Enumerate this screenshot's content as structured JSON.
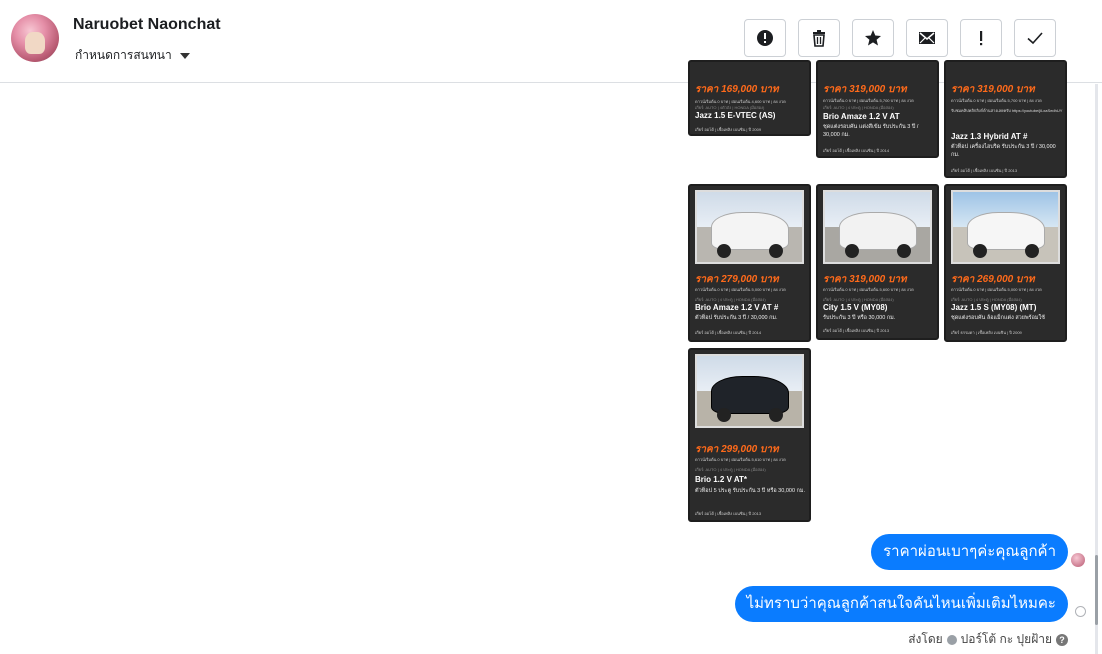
{
  "header": {
    "name": "Naruobet Naonchat",
    "subtitle": "กำหนดการสนทนา",
    "actions": [
      "alert-circle-icon",
      "trash-icon",
      "star-icon",
      "mail-icon",
      "exclamation-icon",
      "checkmark-icon"
    ]
  },
  "cards": [
    {
      "price": "ราคา 169,000 บาท",
      "finance": "ดาวน์เริ่มต้น 0 บาท | ผ่อนเริ่มต้น 4,600 บาท | 84 งวด",
      "spec": "เกียร์: AUTO | 4ตัวถัง | HONDA (มือสอง)",
      "model": "Jazz 1.5 E-VTEC (AS)",
      "desc": "",
      "foot": "เกียร์ ออโต้  |  เชื้อเพลิง เบนซิน  |  ปี 2009"
    },
    {
      "price": "ราคา 319,000 บาท",
      "finance": "ดาวน์เริ่มต้น 0 บาท | ผ่อนเริ่มต้น 5,700 บาท | 84 งวด",
      "spec": "เกียร์: AUTO | 4 ประตู | HONDA (มือสอง)",
      "model": "Brio Amaze 1.2 V AT",
      "desc": "ชุดแต่งรอบคัน แต่งสีเข้ม รับประกัน 3 ปี / 30,000 กม.",
      "foot": "เกียร์ ออโต้  |  เชื้อเพลิง เบนซิน  |  ปี 2014"
    },
    {
      "price": "ราคา 319,000 บาท",
      "finance": "ดาวน์เริ่มต้น 0 บาท | ผ่อนเริ่มต้น 5,700 บาท | 84 งวด",
      "spec": "รับชมคลิปคลิกลิงก์ด้านล่างเลยครับ https://youtube/jiLxaSedhUY",
      "model": "Jazz 1.3 Hybrid AT #",
      "desc": "ตัวท็อป เครื่องไฮบริด รับประกัน 3 ปี / 30,000 กม.",
      "foot": "เกียร์ ออโต้  |  เชื้อเพลิง เบนซิน  |  ปี 2013"
    },
    {
      "price": "ราคา 279,000 บาท",
      "finance": "ดาวน์เริ่มต้น 0 บาท | ผ่อนเริ่มต้น 5,000 บาท | 84 งวด",
      "spec": "เกียร์: AUTO | 4 ประตู | HONDA (มือสอง)",
      "model": "Brio Amaze 1.2 V AT #",
      "desc": "ตัวท็อป รับประกัน 3 ปี / 30,000 กม.",
      "foot": "เกียร์ ออโต้  |  เชื้อเพลิง เบนซิน  |  ปี 2014"
    },
    {
      "price": "ราคา 319,000 บาท",
      "finance": "ดาวน์เริ่มต้น 0 บาท | ผ่อนเริ่มต้น 5,600 บาท | 84 งวด",
      "spec": "เกียร์: AUTO | 4 ประตู | HONDA (มือสอง)",
      "model": "City 1.5 V (MY08)",
      "desc": "รับประกัน 3 ปี หรือ 30,000 กม.",
      "foot": "เกียร์ ออโต้  |  เชื้อเพลิง เบนซิน  |  ปี 2013"
    },
    {
      "price": "ราคา 269,000 บาท",
      "finance": "ดาวน์เริ่มต้น 0 บาท | ผ่อนเริ่มต้น 5,000 บาท | 84 งวด",
      "spec": "เกียร์: AUTO | 4 ประตู | HONDA (มือสอง)",
      "model": "Jazz 1.5 S (MY08) (MT)",
      "desc": "ชุดแต่งรอบคัน ล้อแม็กแต่ง สวยพร้อมใช้",
      "foot": "เกียร์ ธรรมดา  |  เชื้อเพลิง เบนซิน  |  ปี 2009"
    },
    {
      "price": "ราคา 299,000 บาท",
      "finance": "ดาวน์เริ่มต้น 0 บาท | ผ่อนเริ่มต้น 5,610 บาท | 84 งวด",
      "spec": "เกียร์: AUTO | 4 ประตู | HONDA (มือสอง)",
      "model": "Brio 1.2 V AT*",
      "desc": "ตัวท็อป 5 ประตู รับประกัน 3 ปี หรือ 30,000 กม.",
      "foot": "เกียร์ ออโต้  |  เชื้อเพลิง เบนซิน  |  ปี 2013"
    }
  ],
  "messages": [
    {
      "text": "ราคาผ่อนเบาๆค่ะคุณลูกค้า"
    },
    {
      "text": "ไม่ทราบว่าคุณลูกค้าสนใจคันไหนเพิ่มเติมไหมคะ"
    }
  ],
  "sent_by": {
    "prefix": "ส่งโดย",
    "sender": "ปอร์โต้ กะ ปุยฝ้าย"
  },
  "colors": {
    "accent": "#0a7cff",
    "price": "#ff6a1a",
    "card_bg": "#2b2b2b"
  }
}
